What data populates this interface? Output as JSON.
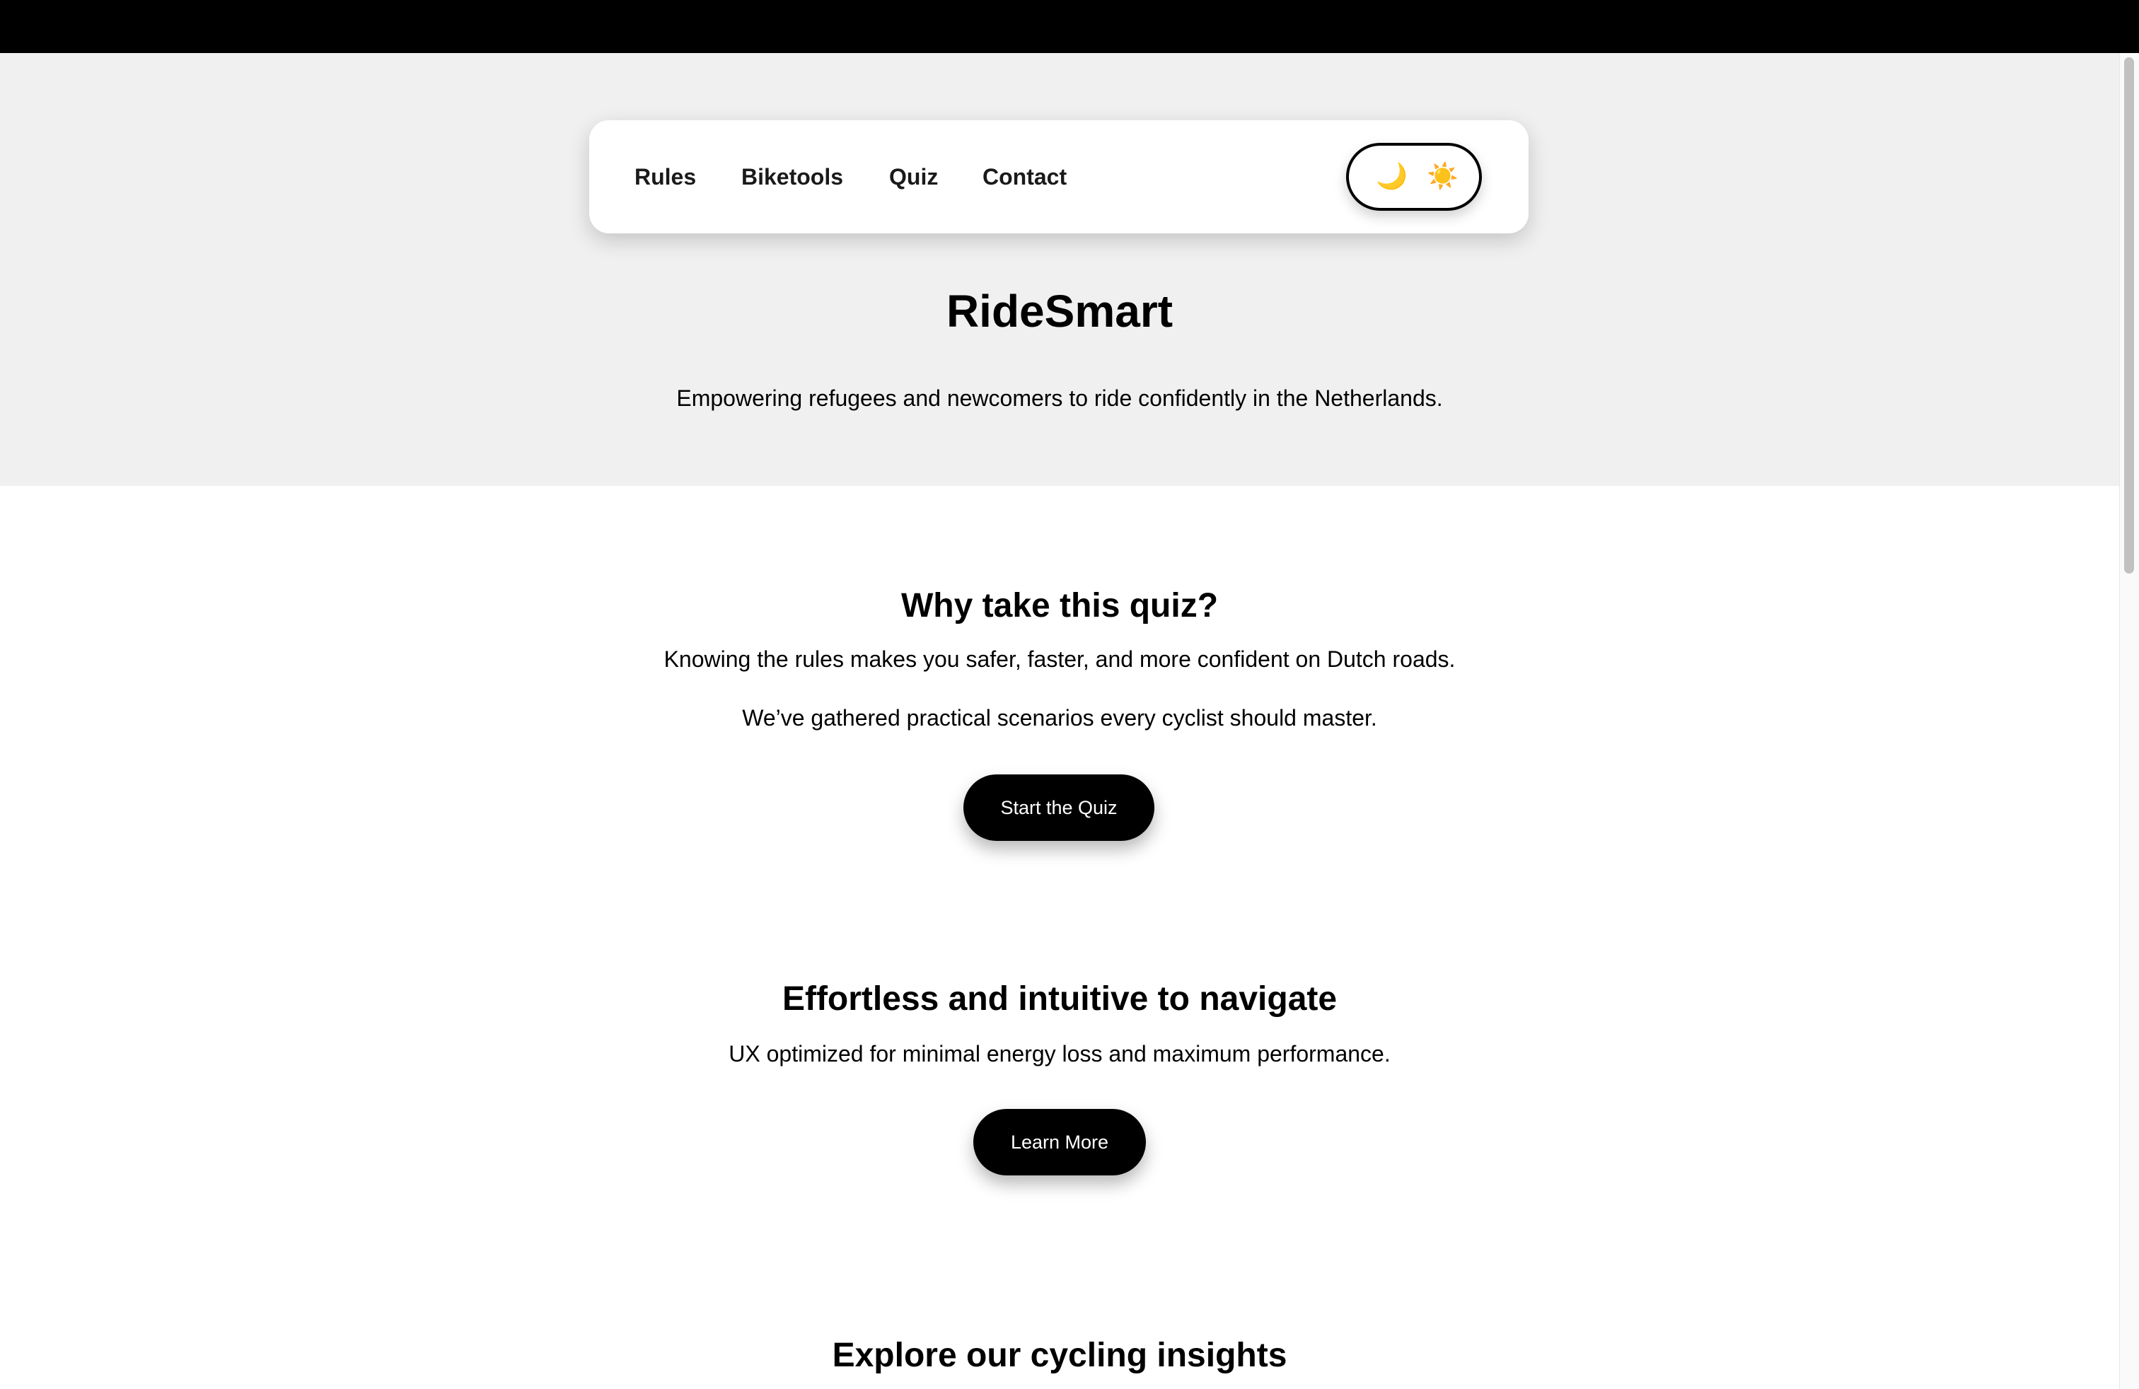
{
  "nav": {
    "links": [
      {
        "label": "Rules"
      },
      {
        "label": "Biketools"
      },
      {
        "label": "Quiz"
      },
      {
        "label": "Contact"
      }
    ],
    "theme_toggle": {
      "dark_icon": "🌙",
      "light_icon": "☀️"
    }
  },
  "hero": {
    "title": "RideSmart",
    "subtitle": "Empowering refugees and newcomers to ride confidently in the Netherlands."
  },
  "why_quiz": {
    "title": "Why take this quiz?",
    "text1": "Knowing the rules makes you safer, faster, and more confident on Dutch roads.",
    "text2": "We’ve gathered practical scenarios every cyclist should master.",
    "button": "Start the Quiz"
  },
  "navigate": {
    "title": "Effortless and intuitive to navigate",
    "text": "UX optimized for minimal energy loss and maximum performance.",
    "button": "Learn More"
  },
  "insights": {
    "title": "Explore our cycling insights"
  },
  "colors": {
    "hero_background": "#f0f0f0",
    "button_background": "#000000",
    "button_text": "#ffffff"
  }
}
